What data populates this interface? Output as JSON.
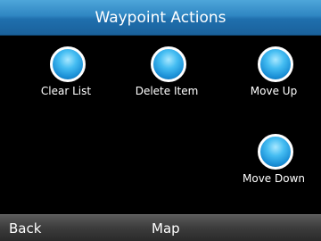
{
  "header": {
    "title": "Waypoint Actions"
  },
  "actions": [
    {
      "label": "Clear List",
      "icon": "blue-orb-icon"
    },
    {
      "label": "Delete Item",
      "icon": "blue-orb-icon"
    },
    {
      "label": "Move Up",
      "icon": "blue-orb-icon"
    },
    {
      "label": "Move Down",
      "icon": "blue-orb-icon"
    }
  ],
  "softkeys": {
    "left": "Back",
    "center": "Map"
  },
  "colors": {
    "title_bar": "#2f86c2",
    "background": "#000000",
    "orb": "#1a8fd6",
    "softkey_bar": "#3c3c3c"
  }
}
